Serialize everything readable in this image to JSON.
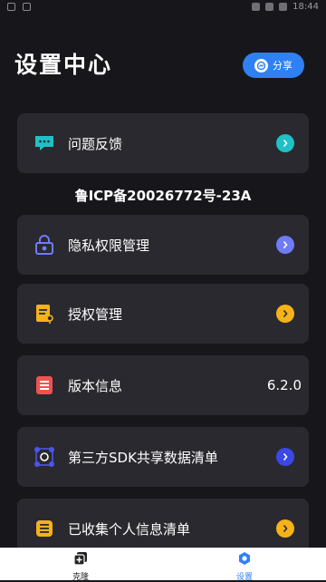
{
  "status_bar": {
    "time": "18:44"
  },
  "header": {
    "title": "设置中心",
    "share_label": "分享"
  },
  "icp_text": "鲁ICP备20026772号-23A",
  "menu": [
    {
      "id": "feedback",
      "label": "问题反馈",
      "icon": "chat-bubble-icon",
      "icon_color": "#1fc0c6",
      "chevron_color": "#1fc0c6"
    },
    {
      "id": "privacy",
      "label": "隐私权限管理",
      "icon": "lock-icon",
      "icon_color": "#6f7cf6",
      "chevron_color": "#6f7cf6"
    },
    {
      "id": "auth",
      "label": "授权管理",
      "icon": "document-key-icon",
      "icon_color": "#f7b21a",
      "chevron_color": "#f7b21a"
    },
    {
      "id": "version",
      "label": "版本信息",
      "value": "6.2.0",
      "icon": "list-document-icon",
      "icon_color": "#ef5350"
    },
    {
      "id": "sdk",
      "label": "第三方SDK共享数据清单",
      "icon": "network-icon",
      "icon_color": "#4a56e8",
      "chevron_color": "#3b48e6"
    },
    {
      "id": "collected",
      "label": "已收集个人信息清单",
      "icon": "info-list-icon",
      "icon_color": "#f7b21a",
      "chevron_color": "#f7b21a"
    }
  ],
  "bottom_nav": [
    {
      "label": "克隆",
      "icon": "clone-icon",
      "color": "#222222"
    },
    {
      "label": "设置",
      "icon": "settings-icon",
      "color": "#2f80f3"
    }
  ]
}
